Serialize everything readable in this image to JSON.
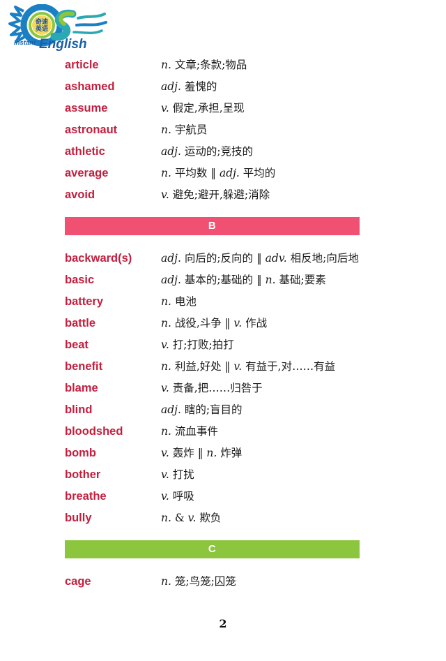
{
  "logo": {
    "name": "instant-english-logo",
    "chinese_text_line1": "奇速",
    "chinese_text_line2": "英语",
    "instant_label": "Instant",
    "english_label": "English",
    "colors": {
      "blue": "#1b5fa8",
      "teal": "#2aa9b5",
      "green": "#8cc63e",
      "yellow": "#f3d33c"
    }
  },
  "colors": {
    "word_red": "#c2203f",
    "banner_b_pink": "#f05172",
    "banner_c_green": "#8cc63e",
    "definition_black": "#1a1a1a",
    "page_background": "#ffffff"
  },
  "sections": [
    {
      "letter": "",
      "banner_color": "",
      "entries": [
        {
          "word": "article",
          "pos": "n.",
          "definition": "n. 文章;条款;物品"
        },
        {
          "word": "ashamed",
          "pos": "adj.",
          "definition": "adj. 羞愧的"
        },
        {
          "word": "assume",
          "pos": "v.",
          "definition": "v. 假定,承担,呈现"
        },
        {
          "word": "astronaut",
          "pos": "n.",
          "definition": "n. 宇航员"
        },
        {
          "word": "athletic",
          "pos": "adj.",
          "definition": "adj. 运动的;竞技的"
        },
        {
          "word": "average",
          "pos": "n.",
          "definition": "n. 平均数 ‖ adj. 平均的"
        },
        {
          "word": "avoid",
          "pos": "v.",
          "definition": "v. 避免;避开,躲避;消除"
        }
      ]
    },
    {
      "letter": "B",
      "banner_color": "#f05172",
      "entries": [
        {
          "word": "backward(s)",
          "pos": "adj.",
          "definition": "adj. 向后的;反向的 ‖ adv. 相反地;向后地"
        },
        {
          "word": "basic",
          "pos": "adj.",
          "definition": "adj. 基本的;基础的 ‖ n. 基础;要素"
        },
        {
          "word": "battery",
          "pos": "n.",
          "definition": "n. 电池"
        },
        {
          "word": "battle",
          "pos": "n.",
          "definition": "n. 战役,斗争 ‖ v. 作战"
        },
        {
          "word": "beat",
          "pos": "v.",
          "definition": "v. 打;打败;拍打"
        },
        {
          "word": "benefit",
          "pos": "n.",
          "definition": "n. 利益,好处 ‖ v. 有益于,对……有益"
        },
        {
          "word": "blame",
          "pos": "v.",
          "definition": "v. 责备,把……归咎于"
        },
        {
          "word": "blind",
          "pos": "adj.",
          "definition": "adj. 瞎的;盲目的"
        },
        {
          "word": "bloodshed",
          "pos": "n.",
          "definition": "n. 流血事件"
        },
        {
          "word": "bomb",
          "pos": "v.",
          "definition": "v. 轰炸 ‖ n. 炸弹"
        },
        {
          "word": "bother",
          "pos": "v.",
          "definition": "v. 打扰"
        },
        {
          "word": "breathe",
          "pos": "v.",
          "definition": "v. 呼吸"
        },
        {
          "word": "bully",
          "pos": "n.",
          "definition": "n. & v. 欺负"
        }
      ]
    },
    {
      "letter": "C",
      "banner_color": "#8cc63e",
      "entries": [
        {
          "word": "cage",
          "pos": "n.",
          "definition": "n. 笼;鸟笼;囚笼"
        }
      ]
    }
  ],
  "footer": {
    "page_number": "2"
  }
}
